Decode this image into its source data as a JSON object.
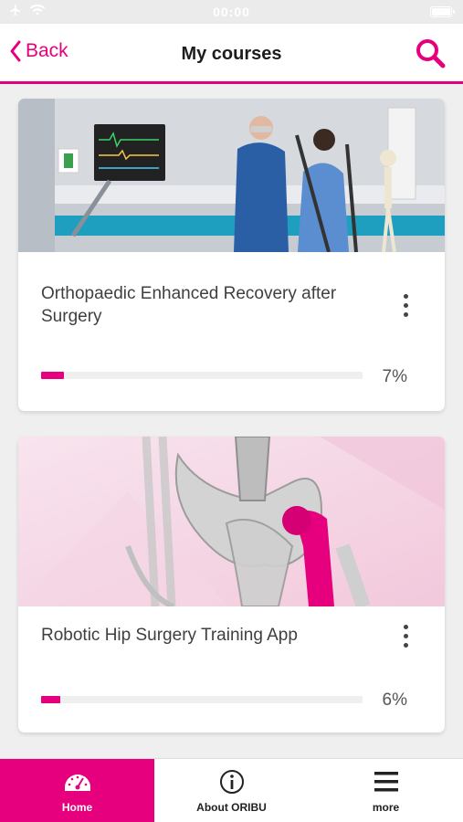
{
  "status_bar": {
    "time": "00:00"
  },
  "nav": {
    "back_label": "Back",
    "title": "My courses"
  },
  "courses": [
    {
      "title": "Orthopaedic Enhanced Recovery after Surgery",
      "progress_label": "7%",
      "progress": 0.07
    },
    {
      "title": "Robotic Hip Surgery Training App",
      "progress_label": "6%",
      "progress": 0.06
    }
  ],
  "tabs": [
    {
      "label": "Home",
      "icon": "speedometer-icon",
      "active": true
    },
    {
      "label": "About ORIBU",
      "icon": "info-icon",
      "active": false
    },
    {
      "label": "more",
      "icon": "menu-icon",
      "active": false
    }
  ],
  "colors": {
    "accent": "#e6007e",
    "background": "#efefef"
  }
}
